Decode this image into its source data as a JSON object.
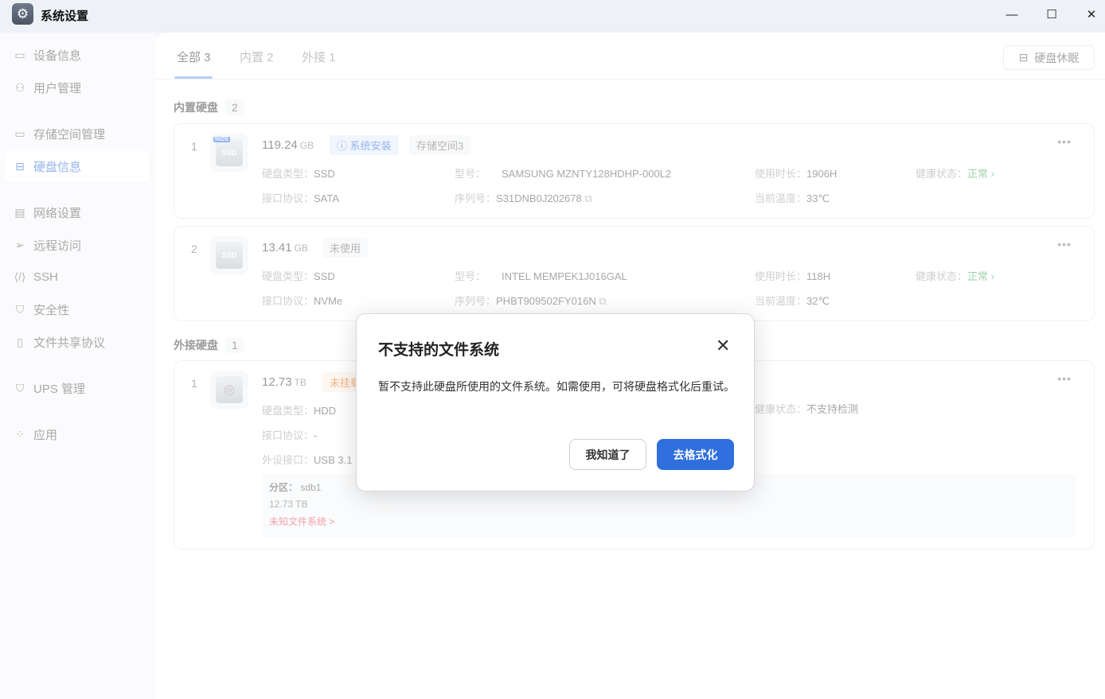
{
  "window": {
    "title": "系统设置",
    "minimize": "—",
    "maximize": "☐",
    "close": "✕"
  },
  "sidebar": {
    "items": [
      {
        "label": "设备信息",
        "icon": "▭"
      },
      {
        "label": "用户管理",
        "icon": "⚇"
      },
      {
        "label": "存储空间管理",
        "icon": "▭"
      },
      {
        "label": "硬盘信息",
        "icon": "⊟"
      },
      {
        "label": "网络设置",
        "icon": "▤"
      },
      {
        "label": "远程访问",
        "icon": "➢"
      },
      {
        "label": "SSH",
        "icon": "⟨/⟩"
      },
      {
        "label": "安全性",
        "icon": "⛉"
      },
      {
        "label": "文件共享协议",
        "icon": "▯"
      },
      {
        "label": "UPS 管理",
        "icon": "⛉"
      },
      {
        "label": "应用",
        "icon": "⁘"
      }
    ]
  },
  "tabs": [
    {
      "label": "全部 3"
    },
    {
      "label": "内置 2"
    },
    {
      "label": "外接 1"
    }
  ],
  "sleep_button": "硬盘休眠",
  "internal": {
    "title": "内置硬盘",
    "count": "2",
    "disks": [
      {
        "index": "1",
        "badge": "fnOS",
        "icon_label": "SSD",
        "capacity": "119.24",
        "unit": "GB",
        "tags": [
          "系统安装",
          "存储空间3"
        ],
        "type": "SSD",
        "protocol": "SATA",
        "model": "SAMSUNG MZNTY128HDHP-000L2",
        "serial": "S31DNB0J202678",
        "hours": "1906H",
        "temp": "33℃",
        "health": "正常"
      },
      {
        "index": "2",
        "icon_label": "SSD",
        "capacity": "13.41",
        "unit": "GB",
        "tags": [
          "未使用"
        ],
        "type": "SSD",
        "protocol": "NVMe",
        "model": "INTEL MEMPEK1J016GAL",
        "serial": "PHBT909502FY016N",
        "hours": "118H",
        "temp": "32℃",
        "health": "正常"
      }
    ]
  },
  "external": {
    "title": "外接硬盘",
    "count": "1",
    "disks": [
      {
        "index": "1",
        "capacity": "12.73",
        "unit": "TB",
        "tags": [
          "未挂载"
        ],
        "type": "HDD",
        "protocol": "-",
        "port": "USB 3.1",
        "health": "不支持检测",
        "partition": {
          "label": "分区：",
          "name": "sdb1",
          "size": "12.73 TB",
          "fs": "未知文件系统 >"
        }
      }
    ]
  },
  "labels": {
    "type": "硬盘类型：",
    "protocol": "接口协议：",
    "model": "型号：",
    "serial": "序列号：",
    "hours": "使用时长：",
    "temp": "当前温度：",
    "health": "健康状态：",
    "port": "外设接口："
  },
  "dialog": {
    "title": "不支持的文件系统",
    "message": "暂不支持此硬盘所使用的文件系统。如需使用，可将硬盘格式化后重试。",
    "cancel": "我知道了",
    "confirm": "去格式化"
  }
}
